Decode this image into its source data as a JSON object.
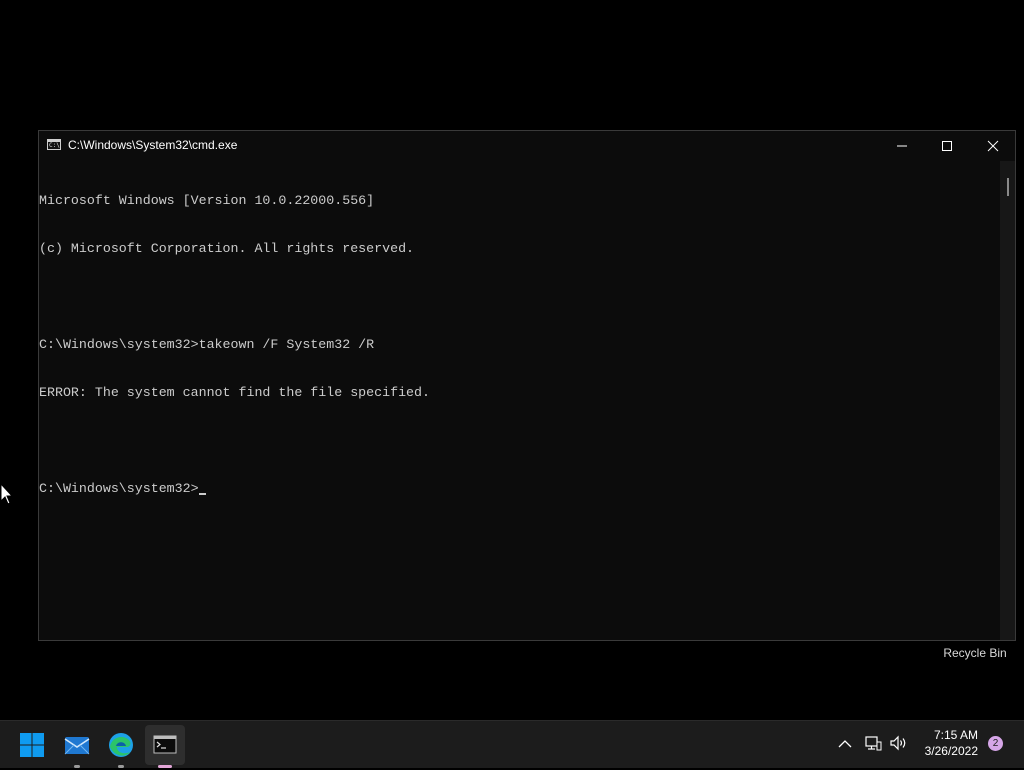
{
  "window": {
    "title": "C:\\Windows\\System32\\cmd.exe",
    "icon_text": "C:\\"
  },
  "console": {
    "lines": [
      "Microsoft Windows [Version 10.0.22000.556]",
      "(c) Microsoft Corporation. All rights reserved.",
      "",
      "C:\\Windows\\system32>takeown /F System32 /R",
      "ERROR: The system cannot find the file specified.",
      ""
    ],
    "prompt": "C:\\Windows\\system32>"
  },
  "desktop": {
    "recycle_bin_label": "Recycle Bin"
  },
  "taskbar": {
    "apps": [
      {
        "name": "start",
        "icon": "windows-logo-icon"
      },
      {
        "name": "mail",
        "icon": "mail-icon"
      },
      {
        "name": "edge",
        "icon": "edge-icon"
      },
      {
        "name": "cmd",
        "icon": "terminal-icon"
      }
    ],
    "clock_time": "7:15 AM",
    "clock_date": "3/26/2022",
    "notification_count": "2"
  },
  "colors": {
    "console_bg": "#0c0c0c",
    "console_text": "#cccccc",
    "taskbar_bg": "#1c1c1c",
    "windows_blue": "#0078d4",
    "badge": "#d6a6e8"
  }
}
